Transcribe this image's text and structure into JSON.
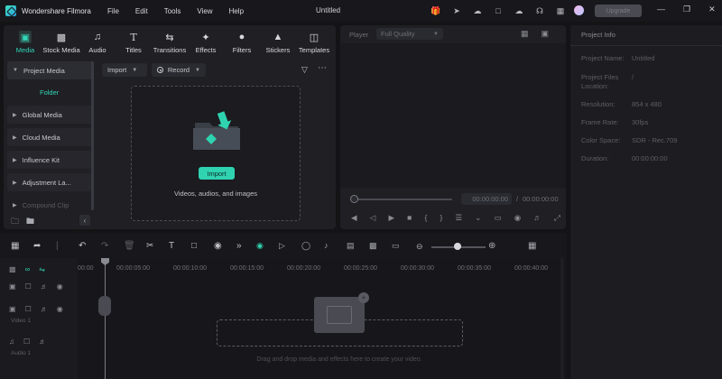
{
  "app": {
    "name": "Wondershare Filmora",
    "doc_title": "Untitled",
    "upgrade_label": "Upgrade"
  },
  "menu": [
    "File",
    "Edit",
    "Tools",
    "View",
    "Help"
  ],
  "tabs": [
    {
      "label": "Media",
      "icon": "media-icon",
      "active": true
    },
    {
      "label": "Stock Media",
      "icon": "stock-media-icon"
    },
    {
      "label": "Audio",
      "icon": "audio-icon"
    },
    {
      "label": "Titles",
      "icon": "titles-icon"
    },
    {
      "label": "Transitions",
      "icon": "transitions-icon"
    },
    {
      "label": "Effects",
      "icon": "effects-icon"
    },
    {
      "label": "Filters",
      "icon": "filters-icon"
    },
    {
      "label": "Stickers",
      "icon": "stickers-icon"
    },
    {
      "label": "Templates",
      "icon": "templates-icon"
    }
  ],
  "sidebar": {
    "items": [
      {
        "label": "Project Media",
        "open": true
      },
      {
        "label": "Global Media"
      },
      {
        "label": "Cloud Media"
      },
      {
        "label": "Influence Kit"
      },
      {
        "label": "Adjustment La..."
      },
      {
        "label": "Compound Clip"
      }
    ],
    "sub_label": "Folder"
  },
  "media_toolbar": {
    "import_label": "Import",
    "record_label": "Record"
  },
  "dropzone": {
    "button_label": "Import",
    "caption": "Videos, audios, and images"
  },
  "player": {
    "label": "Player",
    "quality": "Full Quality",
    "current_time": "00:00:00:00",
    "separator": "/",
    "total_time": "00:00:00:00"
  },
  "project_info": {
    "title": "Project Info",
    "rows": [
      {
        "key": "Project Name:",
        "value": "Untitled"
      },
      {
        "key": "Project Files Location:",
        "value": "/"
      },
      {
        "key": "Resolution:",
        "value": "854 x 480"
      },
      {
        "key": "Frame Rate:",
        "value": "30fps"
      },
      {
        "key": "Color Space:",
        "value": "SDR - Rec.709"
      },
      {
        "key": "Duration:",
        "value": "00:00:00:00"
      }
    ]
  },
  "timeline": {
    "ruler": [
      "00:00",
      "00:00:05:00",
      "00:00:10:00",
      "00:00:15:00",
      "00:00:20:00",
      "00:00:25:00",
      "00:00:30:00",
      "00:00:35:00",
      "00:00:40:00"
    ],
    "tracks": [
      "Video 1",
      "Audio 1"
    ],
    "drop_text": "Drag and drop media and effects here to create your video.",
    "zoom_level": 0.48
  },
  "colors": {
    "accent": "#2fd3b0",
    "bg": "#141417",
    "panel": "#1f1f24"
  }
}
